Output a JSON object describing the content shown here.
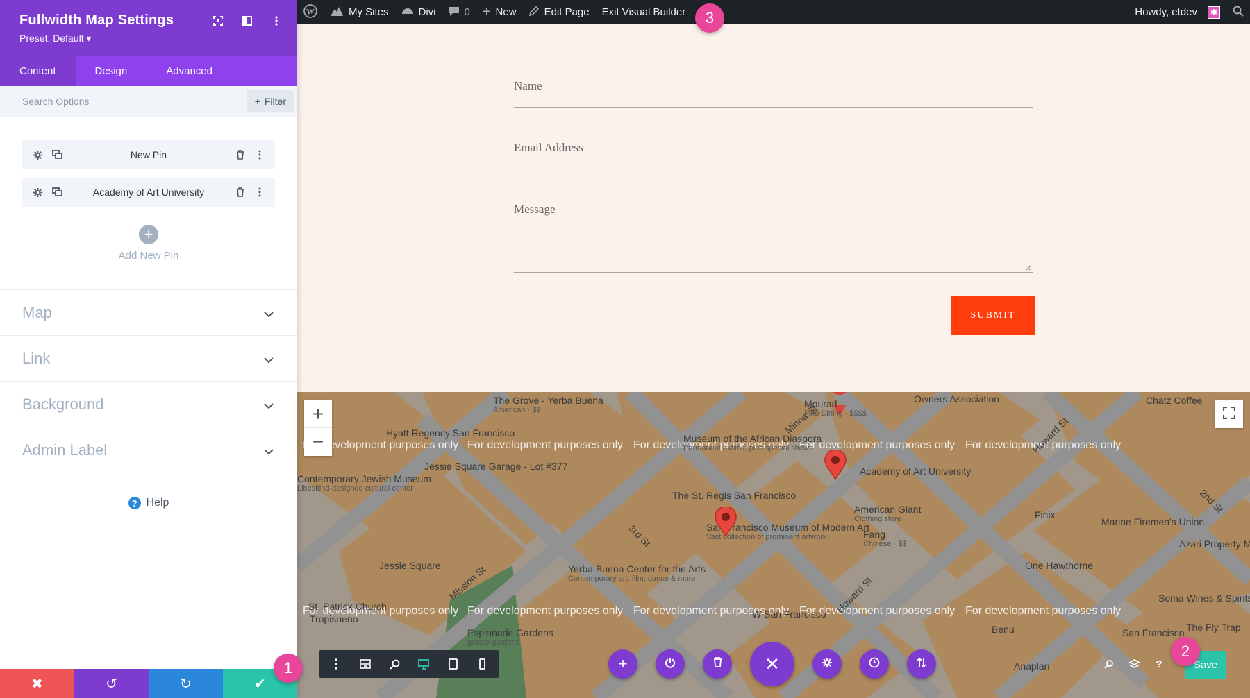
{
  "admin_bar": {
    "items": [
      {
        "label": "My Sites",
        "icon": "my-sites-icon"
      },
      {
        "label": "Divi",
        "icon": "divi-icon"
      },
      {
        "label": "0",
        "icon": "comment-icon"
      },
      {
        "label": "New",
        "icon": "plus-icon"
      },
      {
        "label": "Edit Page",
        "icon": "pencil-icon"
      },
      {
        "label": "Exit Visual Builder",
        "icon": ""
      }
    ],
    "greeting": "Howdy, etdev"
  },
  "steps": [
    "1",
    "2",
    "3"
  ],
  "panel": {
    "title": "Fullwidth Map Settings",
    "preset": "Preset: Default",
    "tabs": [
      "Content",
      "Design",
      "Advanced"
    ],
    "active_tab": "Content",
    "search_placeholder": "Search Options",
    "filter_label": "Filter",
    "pins": [
      "New Pin",
      "Academy of Art University"
    ],
    "add_pin_label": "Add New Pin",
    "toggles": [
      "Map",
      "Link",
      "Background",
      "Admin Label"
    ],
    "help_label": "Help",
    "colors": {
      "header": "#7e3bd0",
      "tabs": "#8f42ec",
      "discard": "#ef5555",
      "undo": "#7e3bd0",
      "redo": "#2b87da",
      "save": "#29c4a9"
    }
  },
  "form": {
    "name_label": "Name",
    "email_label": "Email Address",
    "message_label": "Message",
    "submit_label": "SUBMIT",
    "background": "#fdf1ec",
    "submit_color": "#ff3d0c"
  },
  "map": {
    "watermark": "For development purposes only",
    "places": [
      {
        "name": "Hyatt Regency San Francisco"
      },
      {
        "name": "The Grove - Yerba Buena",
        "sub": "American · $$"
      },
      {
        "name": "Museum of the African Diaspora",
        "sub": "Permanent exhibit, plus special shows"
      },
      {
        "name": "Minna St"
      },
      {
        "name": "Mourad",
        "sub": "Fine Dining · $$$$"
      },
      {
        "name": "Owners Association"
      },
      {
        "name": "Howard St"
      },
      {
        "name": "Chatz Coffee"
      },
      {
        "name": "Jessie Square Garage - Lot #377"
      },
      {
        "name": "Contemporary Jewish Museum",
        "sub": "Libeskind-designed cultural center"
      },
      {
        "name": "The St. Regis San Francisco"
      },
      {
        "name": "Academy of Art University"
      },
      {
        "name": "American Giant",
        "sub": "Clothing store"
      },
      {
        "name": "San Francisco Museum of Modern Art",
        "sub": "Vast collection of prominent artwork"
      },
      {
        "name": "Fang",
        "sub": "Chinese · $$"
      },
      {
        "name": "Finix"
      },
      {
        "name": "Marine Firemen's Union"
      },
      {
        "name": "2nd St"
      },
      {
        "name": "Azari Property Management"
      },
      {
        "name": "3rd St"
      },
      {
        "name": "Jessie Square"
      },
      {
        "name": "Yerba Buena Center for the Arts",
        "sub": "Contemporary art, film, dance & more"
      },
      {
        "name": "One Hawthorne"
      },
      {
        "name": "Mission St"
      },
      {
        "name": "St. Patrick Church"
      },
      {
        "name": "Tropisueno"
      },
      {
        "name": "W San Francisco"
      },
      {
        "name": "Benu"
      },
      {
        "name": "Soma Wines & Spirits"
      },
      {
        "name": "The Fly Trap"
      },
      {
        "name": "San Francisco"
      },
      {
        "name": "Anaplan"
      },
      {
        "name": "Esplanade Gardens",
        "sub": "grassy gardens"
      }
    ],
    "land_color": "#eeae62",
    "road_color": "#bdbdbd",
    "overlay_color": "#6f6f6f"
  },
  "builder_bar": {
    "view_icons": [
      "more-icon",
      "wireframe-icon",
      "zoom-icon",
      "desktop-icon",
      "tablet-icon",
      "phone-icon"
    ],
    "round_icons": [
      "add-icon",
      "power-icon",
      "trash-icon",
      "close-icon",
      "settings-icon",
      "history-icon",
      "portability-icon"
    ],
    "right_icons": [
      "search-icon",
      "layers-icon",
      "help-icon"
    ],
    "save_label": "Save"
  }
}
